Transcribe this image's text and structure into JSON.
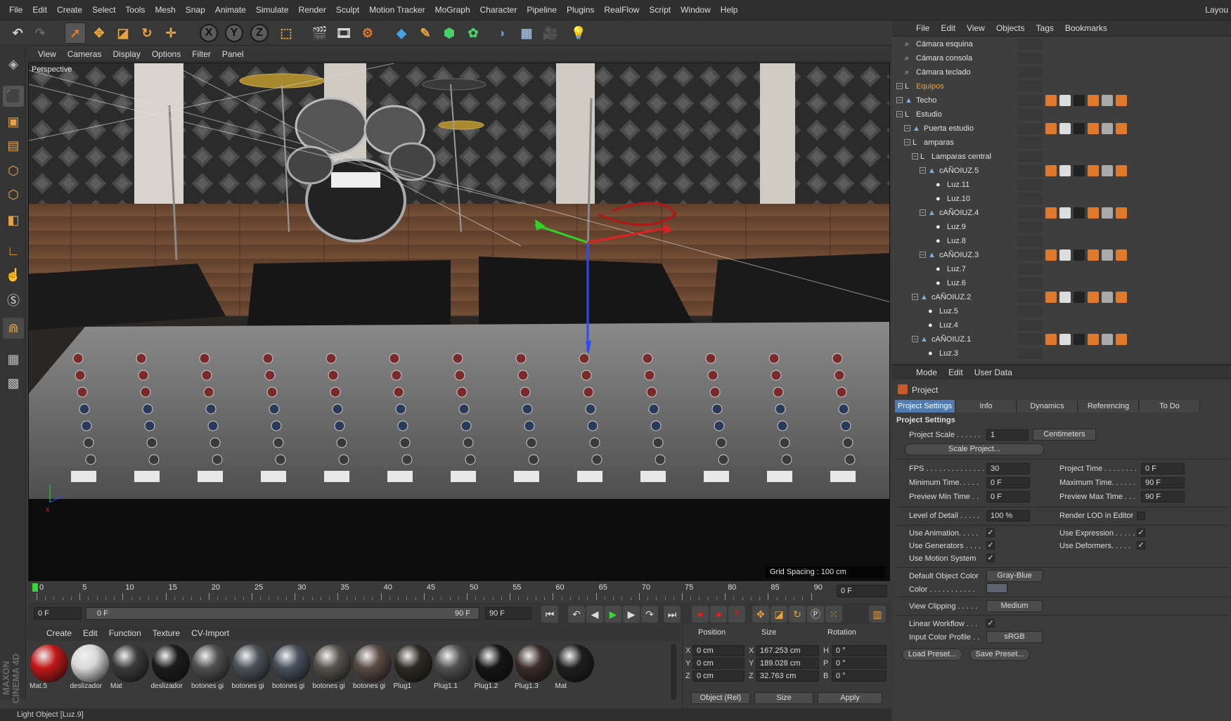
{
  "menubar": {
    "items": [
      "File",
      "Edit",
      "Create",
      "Select",
      "Tools",
      "Mesh",
      "Snap",
      "Animate",
      "Simulate",
      "Render",
      "Sculpt",
      "Motion Tracker",
      "MoGraph",
      "Character",
      "Pipeline",
      "Plugins",
      "RealFlow",
      "Script",
      "Window",
      "Help"
    ],
    "layout_label": "Layou"
  },
  "toolbar": {
    "axis_x": "X",
    "axis_y": "Y",
    "axis_z": "Z"
  },
  "viewport": {
    "menu": [
      "View",
      "Cameras",
      "Display",
      "Options",
      "Filter",
      "Panel"
    ],
    "label": "Perspective",
    "grid_spacing": "Grid Spacing : 100 cm"
  },
  "timeline": {
    "ticks": [
      "0",
      "5",
      "10",
      "15",
      "20",
      "25",
      "30",
      "35",
      "40",
      "45",
      "50",
      "55",
      "60",
      "65",
      "70",
      "75",
      "80",
      "85",
      "90"
    ],
    "end_field": "0 F",
    "current": "0 F",
    "range_start": "0 F",
    "range_end": "90 F",
    "max_field": "90 F"
  },
  "materials": {
    "menu": [
      "Create",
      "Edit",
      "Function",
      "Texture",
      "CV-Import"
    ],
    "items": [
      {
        "name": "Mat.5",
        "color": "#c01818"
      },
      {
        "name": "deslizador",
        "color": "#d8d8d8"
      },
      {
        "name": "Mat",
        "color": "#3a3a3a"
      },
      {
        "name": "deslizador",
        "color": "#1c1c1c"
      },
      {
        "name": "botones gi",
        "color": "#505050"
      },
      {
        "name": "botones gi",
        "color": "#4a5258"
      },
      {
        "name": "botones gi",
        "color": "#46505c"
      },
      {
        "name": "botones gi",
        "color": "#55524a"
      },
      {
        "name": "botones gi",
        "color": "#5a4a44"
      },
      {
        "name": "Plug1",
        "color": "#2e2a22"
      },
      {
        "name": "Plug1.1",
        "color": "#505050"
      },
      {
        "name": "Plug1.2",
        "color": "#151515"
      },
      {
        "name": "Plug1.3",
        "color": "#3a2c2a"
      },
      {
        "name": "Mat",
        "color": "#1e1e1e"
      }
    ]
  },
  "coords": {
    "headers": [
      "Position",
      "Size",
      "Rotation"
    ],
    "pos": [
      {
        "axis": "X",
        "value": "0 cm"
      },
      {
        "axis": "Y",
        "value": "0 cm"
      },
      {
        "axis": "Z",
        "value": "0 cm"
      }
    ],
    "size": [
      {
        "axis": "X",
        "value": "167.253 cm"
      },
      {
        "axis": "Y",
        "value": "189.028 cm"
      },
      {
        "axis": "Z",
        "value": "32.763 cm"
      }
    ],
    "rot": [
      {
        "axis": "H",
        "value": "0 °"
      },
      {
        "axis": "P",
        "value": "0 °"
      },
      {
        "axis": "B",
        "value": "0 °"
      }
    ],
    "mode": "Object (Rel)",
    "size_mode": "Size",
    "apply": "Apply"
  },
  "status": "Light Object [Luz.9]",
  "object_manager": {
    "menu": [
      "File",
      "Edit",
      "View",
      "Objects",
      "Tags",
      "Bookmarks"
    ],
    "rows": [
      {
        "name": "Cámara esquina",
        "depth": 0,
        "icon": "camera",
        "color": "#e0e0e0"
      },
      {
        "name": "Cámara consola",
        "depth": 0,
        "icon": "camera",
        "color": "#e0e0e0"
      },
      {
        "name": "Cámara teclado",
        "depth": 0,
        "icon": "camera",
        "color": "#e0e0e0"
      },
      {
        "name": "Equipos",
        "depth": 0,
        "icon": "null",
        "color": "#e8a33c"
      },
      {
        "name": "Techo",
        "depth": 0,
        "icon": "mesh",
        "color": "#e0e0e0"
      },
      {
        "name": "Estudio",
        "depth": 0,
        "icon": "null",
        "color": "#e0e0e0"
      },
      {
        "name": "Puerta estudio",
        "depth": 1,
        "icon": "mesh",
        "color": "#e0e0e0"
      },
      {
        "name": "amparas",
        "depth": 1,
        "icon": "null",
        "color": "#e0e0e0"
      },
      {
        "name": "Lamparas central",
        "depth": 2,
        "icon": "null",
        "color": "#e0e0e0"
      },
      {
        "name": "cAÑOIUZ.5",
        "depth": 3,
        "icon": "mesh",
        "color": "#e0e0e0"
      },
      {
        "name": "Luz.11",
        "depth": 4,
        "icon": "light",
        "color": "#e0e0e0"
      },
      {
        "name": "Luz.10",
        "depth": 4,
        "icon": "light",
        "color": "#e0e0e0"
      },
      {
        "name": "cAÑOIUZ.4",
        "depth": 3,
        "icon": "mesh",
        "color": "#e0e0e0"
      },
      {
        "name": "Luz.9",
        "depth": 4,
        "icon": "light",
        "color": "#e0e0e0"
      },
      {
        "name": "Luz.8",
        "depth": 4,
        "icon": "light",
        "color": "#e0e0e0"
      },
      {
        "name": "cAÑOIUZ.3",
        "depth": 3,
        "icon": "mesh",
        "color": "#e0e0e0"
      },
      {
        "name": "Luz.7",
        "depth": 4,
        "icon": "light",
        "color": "#e0e0e0"
      },
      {
        "name": "Luz.6",
        "depth": 4,
        "icon": "light",
        "color": "#e0e0e0"
      },
      {
        "name": "cAÑOIUZ.2",
        "depth": 2,
        "icon": "mesh",
        "color": "#e0e0e0"
      },
      {
        "name": "Luz.5",
        "depth": 3,
        "icon": "light",
        "color": "#e0e0e0"
      },
      {
        "name": "Luz.4",
        "depth": 3,
        "icon": "light",
        "color": "#e0e0e0"
      },
      {
        "name": "cAÑOIUZ.1",
        "depth": 2,
        "icon": "mesh",
        "color": "#e0e0e0"
      },
      {
        "name": "Luz.3",
        "depth": 3,
        "icon": "light",
        "color": "#e0e0e0"
      }
    ]
  },
  "attributes": {
    "menu": [
      "Mode",
      "Edit",
      "User Data"
    ],
    "title": "Project",
    "tabs": [
      "Project Settings",
      "Info",
      "Dynamics",
      "Referencing",
      "To Do"
    ],
    "section": "Project Settings",
    "project_scale_label": "Project Scale . . . . . .",
    "project_scale": "1",
    "units": "Centimeters",
    "scale_button": "Scale Project...",
    "fps_label": "FPS . . . . . . . . . . . . . .",
    "fps": "30",
    "min_time_label": "Minimum Time. . . . .",
    "min_time": "0 F",
    "prev_min_label": "Preview Min Time . .",
    "prev_min": "0 F",
    "proj_time_label": "Project Time . . . . . . . .",
    "proj_time": "0 F",
    "max_time_label": "Maximum Time. . . . . .",
    "max_time": "90 F",
    "prev_max_label": "Preview Max Time . . .",
    "prev_max": "90 F",
    "lod_label": "Level of Detail . . . . .",
    "lod": "100 %",
    "render_lod_label": "Render LOD in Editor",
    "use_anim": "Use Animation. . . . .",
    "use_gen": "Use Generators . . . .",
    "use_motion": "Use Motion System",
    "use_expr": "Use Expression . . . . .",
    "use_deform": "Use Deformers. . . . .",
    "def_color_label": "Default Object Color",
    "def_color": "Gray-Blue",
    "color_label": "Color . . . . . . . . . . .",
    "clipping_label": "View Clipping . . . . .",
    "clipping": "Medium",
    "linear_label": "Linear Workflow . . .",
    "input_profile_label": "Input Color Profile . .",
    "input_profile": "sRGB",
    "load_preset": "Load Preset...",
    "save_preset": "Save Preset..."
  }
}
